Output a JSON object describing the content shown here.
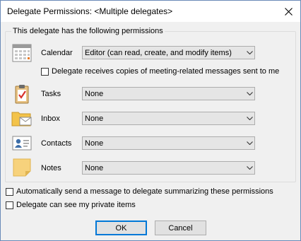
{
  "window": {
    "title": "Delegate Permissions: <Multiple delegates>"
  },
  "group": {
    "label": "This delegate has the following permissions"
  },
  "permissions": [
    {
      "label": "Calendar",
      "value": "Editor (can read, create, and modify items)",
      "icon": "calendar-icon"
    },
    {
      "label": "Tasks",
      "value": "None",
      "icon": "tasks-clipboard-icon"
    },
    {
      "label": "Inbox",
      "value": "None",
      "icon": "inbox-folder-icon"
    },
    {
      "label": "Contacts",
      "value": "None",
      "icon": "contact-card-icon"
    },
    {
      "label": "Notes",
      "value": "None",
      "icon": "sticky-note-icon"
    }
  ],
  "meeting_copies": {
    "label": "Delegate receives copies of meeting-related messages sent to me",
    "checked": false
  },
  "options": {
    "auto_summary": {
      "label": "Automatically send a message to delegate summarizing these permissions",
      "checked": false
    },
    "private_items": {
      "label": "Delegate can see my private items",
      "checked": false
    }
  },
  "buttons": {
    "ok": "OK",
    "cancel": "Cancel"
  },
  "colors": {
    "accent": "#0078d7",
    "dialog_bg": "#f0f0f0"
  }
}
